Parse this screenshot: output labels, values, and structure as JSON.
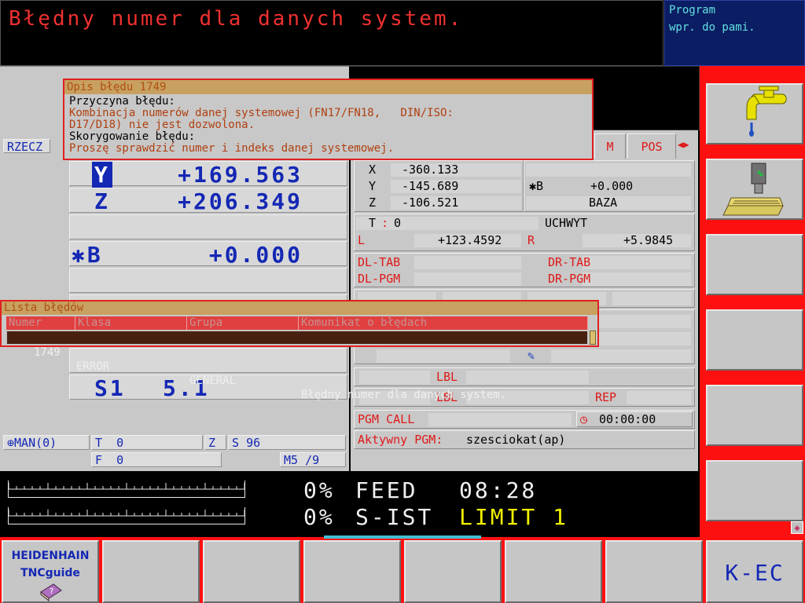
{
  "header": {
    "message": "Błędny numer dla danych system.",
    "mode_line1": "Program",
    "mode_line2": "wpr. do pami."
  },
  "left": {
    "rzecz": "RZECZ",
    "y_axis": "Y",
    "y_val": "+169.563",
    "z_axis": "Z",
    "z_val": "+206.349",
    "b_axis": "✱B",
    "b_val": "+0.000",
    "s_label": "S1",
    "s_val": "5.1",
    "man": "MAN(0)",
    "t_label": "T",
    "t_val": "0",
    "z_short": "Z",
    "s_short": "S",
    "s_short_val": "96",
    "f_label": "F",
    "f_val": "0",
    "m_label": "M5 /9"
  },
  "tabs": {
    "m": "M",
    "pos": "POS"
  },
  "status": {
    "x_label": "X",
    "x_val": "-360.133",
    "y_label": "Y",
    "y_val": "-145.689",
    "z_label": "Z",
    "z_val": "-106.521",
    "b_label": "✱B",
    "b_val": "+0.000",
    "baza": "BAZA",
    "t_label": "T",
    "t_colon": ":",
    "t_val": "0",
    "uchwyt": "UCHWYT",
    "l_label": "L",
    "l_val": "+123.4592",
    "r_label": "R",
    "r_val": "+5.9845",
    "dl_tab": "DL-TAB",
    "dr_tab": "DR-TAB",
    "dl_pgm": "DL-PGM",
    "dr_pgm": "DR-PGM",
    "lbl1": "LBL",
    "lbl2": "LBL",
    "rep": "REP",
    "pgm_call": "PGM CALL",
    "timer": "00:00:00",
    "aktywny_label": "Aktywny PGM:",
    "aktywny_val": "szesciokat(ap)"
  },
  "dialog": {
    "title": "Opis błędu 1749",
    "cause_label": "Przyczyna błędu:",
    "cause_line1": "Kombinacja numerów danej systemowej (FN17/FN18,   DIN/ISO:",
    "cause_line2": "D17/D18) nie jest dozwolona.",
    "fix_label": "Skorygowanie błędu:",
    "fix_text": "Proszę sprawdzić numer i indeks danej systemowej."
  },
  "error_list": {
    "title": "Lista błędów",
    "columns": [
      "Numer",
      "Klasa",
      "Grupa",
      "Komunikat o błędach"
    ],
    "rows": [
      {
        "numer": "1749",
        "klasa": "ERROR",
        "grupa": "GENERAL",
        "komunikat": "Błędny numer dla danych system."
      }
    ]
  },
  "bottom": {
    "feed_pct": "0%",
    "feed_label": "FEED",
    "clock": "08:28",
    "sist_pct": "0%",
    "sist_label": "S-IST",
    "limit": "LIMIT 1"
  },
  "softkeys": {
    "tnc_line1": "HEIDENHAIN",
    "tnc_line2": "TNCguide",
    "kec": "K-EC"
  },
  "colors": {
    "accent_red": "#ff1010",
    "header_blue": "#0b1d63",
    "value_blue": "#1428b4",
    "limit_yellow": "#f0f000"
  }
}
